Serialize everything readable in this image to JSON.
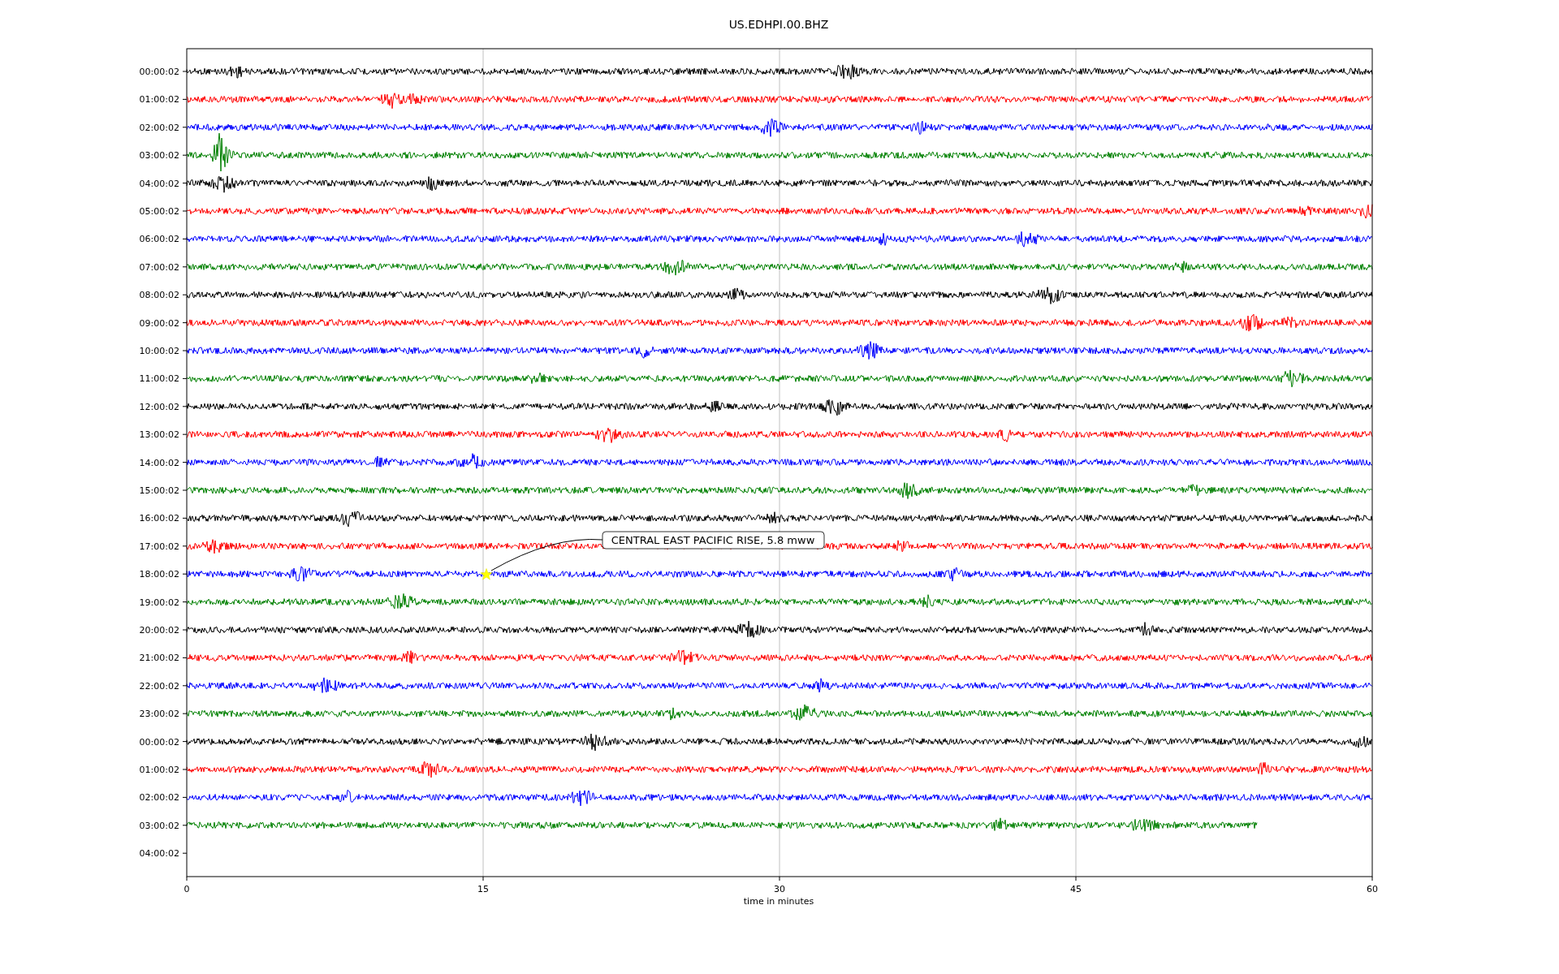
{
  "title": "US.EDHPI.00.BHZ",
  "x_axis": {
    "label": "time in minutes",
    "ticks": [
      "0",
      "15",
      "30",
      "45",
      "60"
    ]
  },
  "rows": [
    {
      "label": "00:00:02",
      "color": "#000000",
      "kind": "full"
    },
    {
      "label": "01:00:02",
      "color": "#ff0000",
      "kind": "full"
    },
    {
      "label": "02:00:02",
      "color": "#0000ff",
      "kind": "full"
    },
    {
      "label": "03:00:02",
      "color": "#008000",
      "kind": "full"
    },
    {
      "label": "04:00:02",
      "color": "#000000",
      "kind": "full"
    },
    {
      "label": "05:00:02",
      "color": "#ff0000",
      "kind": "full"
    },
    {
      "label": "06:00:02",
      "color": "#0000ff",
      "kind": "full"
    },
    {
      "label": "07:00:02",
      "color": "#008000",
      "kind": "full"
    },
    {
      "label": "08:00:02",
      "color": "#000000",
      "kind": "full"
    },
    {
      "label": "09:00:02",
      "color": "#ff0000",
      "kind": "full"
    },
    {
      "label": "10:00:02",
      "color": "#0000ff",
      "kind": "full"
    },
    {
      "label": "11:00:02",
      "color": "#008000",
      "kind": "full"
    },
    {
      "label": "12:00:02",
      "color": "#000000",
      "kind": "full"
    },
    {
      "label": "13:00:02",
      "color": "#ff0000",
      "kind": "full"
    },
    {
      "label": "14:00:02",
      "color": "#0000ff",
      "kind": "full"
    },
    {
      "label": "15:00:02",
      "color": "#008000",
      "kind": "full"
    },
    {
      "label": "16:00:02",
      "color": "#000000",
      "kind": "full"
    },
    {
      "label": "17:00:02",
      "color": "#ff0000",
      "kind": "full"
    },
    {
      "label": "18:00:02",
      "color": "#0000ff",
      "kind": "full"
    },
    {
      "label": "19:00:02",
      "color": "#008000",
      "kind": "full"
    },
    {
      "label": "20:00:02",
      "color": "#000000",
      "kind": "full"
    },
    {
      "label": "21:00:02",
      "color": "#ff0000",
      "kind": "full"
    },
    {
      "label": "22:00:02",
      "color": "#0000ff",
      "kind": "full"
    },
    {
      "label": "23:00:02",
      "color": "#008000",
      "kind": "full"
    },
    {
      "label": "00:00:02",
      "color": "#000000",
      "kind": "full"
    },
    {
      "label": "01:00:02",
      "color": "#ff0000",
      "kind": "full"
    },
    {
      "label": "02:00:02",
      "color": "#0000ff",
      "kind": "full"
    },
    {
      "label": "03:00:02",
      "color": "#008000",
      "kind": "partial"
    },
    {
      "label": "04:00:02",
      "kind": "empty"
    }
  ],
  "annotation": {
    "text": "CENTRAL EAST PACIFIC RISE, 5.8 mww"
  }
}
